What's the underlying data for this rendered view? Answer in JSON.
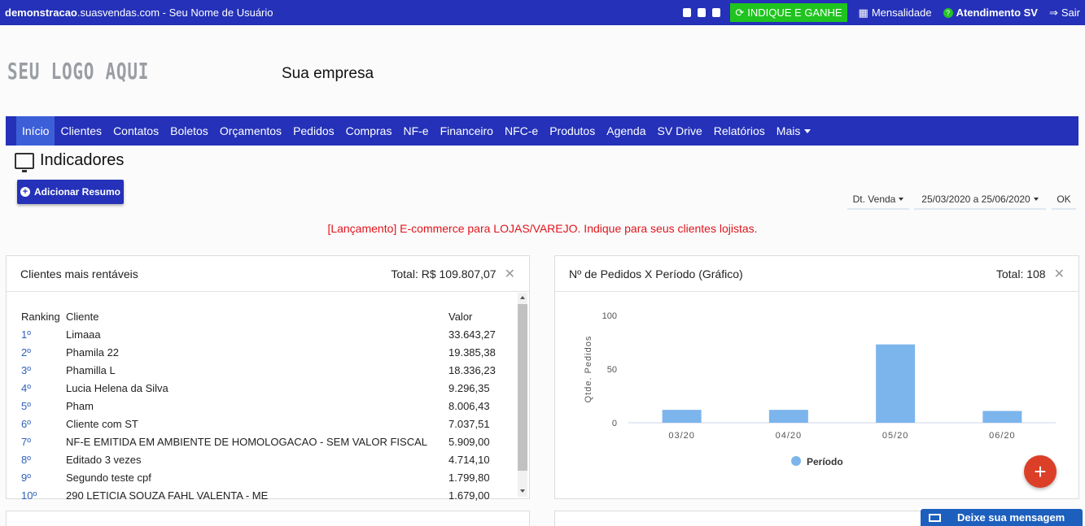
{
  "topbar": {
    "site_bold": "demonstracao",
    "site_rest": ".suasvendas.com",
    "user": " - Seu Nome de Usuário",
    "indique": "INDIQUE E GANHE",
    "mensalidade": "Mensalidade",
    "atendimento": "Atendimento SV",
    "sair": "Sair"
  },
  "header": {
    "logo": "SEU LOGO AQUI",
    "company": "Sua empresa"
  },
  "nav": [
    "Início",
    "Clientes",
    "Contatos",
    "Boletos",
    "Orçamentos",
    "Pedidos",
    "Compras",
    "NF-e",
    "Financeiro",
    "NFC-e",
    "Produtos",
    "Agenda",
    "SV Drive",
    "Relatórios",
    "Mais"
  ],
  "page": {
    "title": "Indicadores",
    "add_button": "Adicionar Resumo",
    "filter_type": "Dt. Venda",
    "filter_range": "25/03/2020 a 25/06/2020",
    "ok": "OK",
    "banner": "[Lançamento] E-commerce para LOJAS/VAREJO. Indique para seus clientes lojistas."
  },
  "card_clients": {
    "title": "Clientes mais rentáveis",
    "total": "Total: R$ 109.807,07",
    "headers": [
      "Ranking",
      "Cliente",
      "Valor"
    ],
    "rows": [
      [
        "1º",
        "Limaaa",
        "33.643,27"
      ],
      [
        "2º",
        "Phamila 22",
        "19.385,38"
      ],
      [
        "3º",
        "Phamilla L",
        "18.336,23"
      ],
      [
        "4º",
        "Lucia Helena da Silva",
        "9.296,35"
      ],
      [
        "5º",
        "Pham",
        "8.006,43"
      ],
      [
        "6º",
        "Cliente com ST",
        "7.037,51"
      ],
      [
        "7º",
        "NF-E EMITIDA EM AMBIENTE DE HOMOLOGACAO - SEM VALOR FISCAL",
        "5.909,00"
      ],
      [
        "8º",
        "Editado 3 vezes",
        "4.714,10"
      ],
      [
        "9º",
        "Segundo teste cpf",
        "1.799,80"
      ],
      [
        "10º",
        "290 LETICIA SOUZA FAHL VALENTA - ME",
        "1.679,00"
      ]
    ]
  },
  "card_orders": {
    "title": "Nº de Pedidos X Período (Gráfico)",
    "total": "Total: 108"
  },
  "chart_data": {
    "type": "bar",
    "categories": [
      "03/20",
      "04/20",
      "05/20",
      "06/20"
    ],
    "series": [
      {
        "name": "Período",
        "values": [
          12,
          12,
          73,
          11
        ]
      }
    ],
    "ylabel": "Qtde. Pedidos",
    "yticks": [
      100,
      50,
      0
    ],
    "ylim": [
      0,
      100
    ],
    "legend": "bottom",
    "color": "#7cb5ec"
  },
  "chat": {
    "label": "Deixe sua mensagem"
  }
}
